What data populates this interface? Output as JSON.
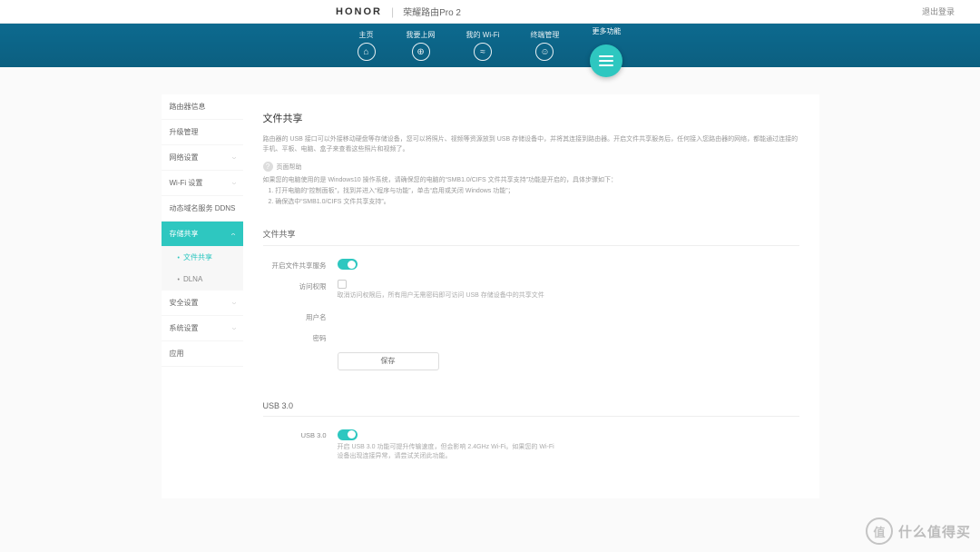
{
  "brand": {
    "logo": "HONOR",
    "model": "荣耀路由Pro 2",
    "logout": "退出登录"
  },
  "nav": {
    "items": [
      {
        "label": "主页",
        "glyph": "⌂"
      },
      {
        "label": "我要上网",
        "glyph": "⊕"
      },
      {
        "label": "我的 Wi-Fi",
        "glyph": "≈"
      },
      {
        "label": "终端管理",
        "glyph": "☺"
      }
    ],
    "more": "更多功能"
  },
  "sidebar": {
    "items": [
      {
        "label": "路由器信息",
        "arrow": false
      },
      {
        "label": "升级管理",
        "arrow": false
      },
      {
        "label": "网络设置",
        "arrow": true
      },
      {
        "label": "Wi-Fi 设置",
        "arrow": true
      },
      {
        "label": "动态域名服务 DDNS",
        "arrow": false
      },
      {
        "label": "存储共享",
        "arrow": true,
        "active": true
      },
      {
        "label": "安全设置",
        "arrow": true
      },
      {
        "label": "系统设置",
        "arrow": true
      },
      {
        "label": "应用",
        "arrow": false
      }
    ],
    "subs": [
      {
        "label": "文件共享",
        "sel": true
      },
      {
        "label": "DLNA",
        "sel": false
      }
    ]
  },
  "page": {
    "title": "文件共享",
    "desc": "路由器的 USB 接口可以外接移动硬盘等存储设备，您可以将照片、视频等资源放到 USB 存储设备中，并将其连接到路由器。开启文件共享服务后，任何接入您路由器的网络，都能通过连接的手机、平板、电脑、盒子来查看这些照片和视频了。",
    "help_label": "页面帮助",
    "help_text_1": "如果您的电脑使用的是 Windows10 操作系统，请确保您的电脑的“SMB1.0/CIFS 文件共享支持”功能是开启的，具体步骤如下：",
    "help_text_2": "1. 打开电脑的“控制面板”，找到并进入“程序与功能”，单击“启用或关闭 Windows 功能”；",
    "help_text_3": "2. 确保选中“SMB1.0/CIFS 文件共享支持”。",
    "sec_share": {
      "title": "文件共享",
      "enable_label": "开启文件共享服务",
      "access_label": "访问权限",
      "access_hint": "取消访问权限后，所有用户无需密码即可访问 USB 存储设备中的共享文件",
      "user_label": "用户名",
      "pass_label": "密码",
      "save": "保存"
    },
    "sec_usb": {
      "title": "USB 3.0",
      "enable_label": "USB 3.0",
      "hint": "开启 USB 3.0 功能可提升传输速度，但会影响 2.4GHz Wi-Fi。如果您的 Wi-Fi 设备出现连接异常，请尝试关闭此功能。"
    }
  },
  "watermark": {
    "badge": "值",
    "text": "什么值得买"
  }
}
